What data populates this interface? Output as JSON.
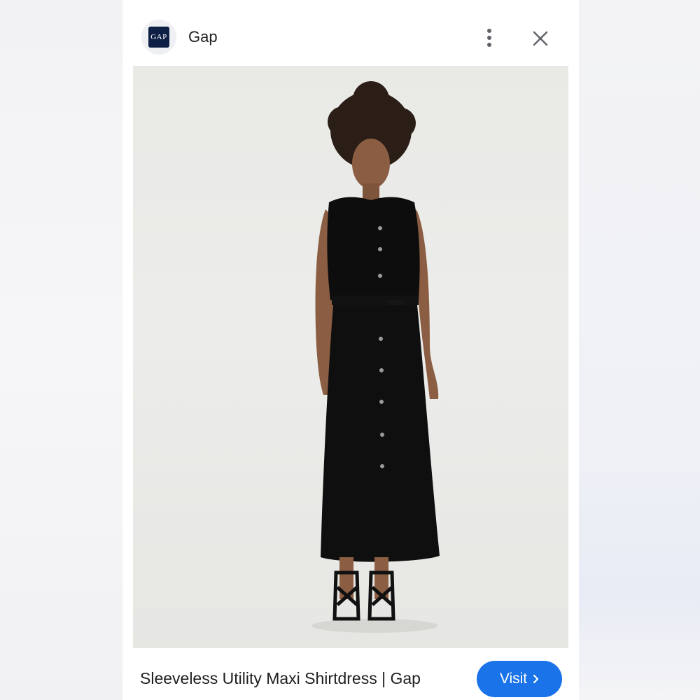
{
  "header": {
    "brand_logo_text": "GAP",
    "brand_name": "Gap",
    "menu_icon": "more-vert-icon",
    "close_icon": "close-icon"
  },
  "image": {
    "subject": "product-photo"
  },
  "footer": {
    "product_title": "Sleeveless Utility Maxi Shirtdress | Gap",
    "visit_label": "Visit",
    "visit_icon": "chevron-right-icon"
  },
  "colors": {
    "accent": "#1a73e8",
    "brand_logo_bg": "#0e1f45"
  }
}
